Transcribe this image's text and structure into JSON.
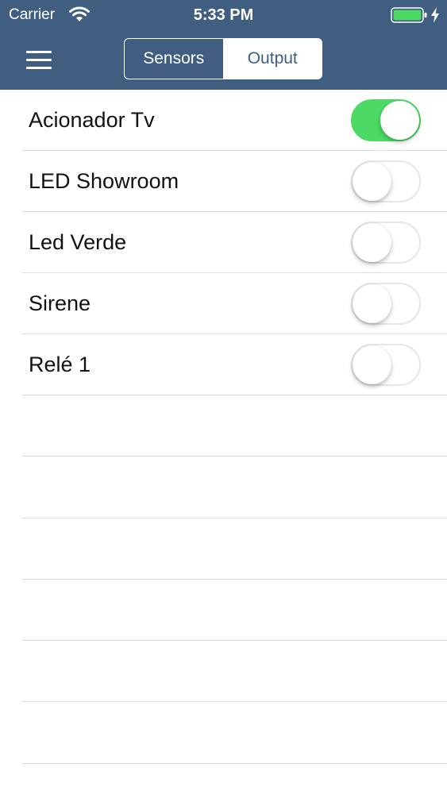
{
  "status_bar": {
    "carrier": "Carrier",
    "time": "5:33 PM",
    "battery_color": "#4cd964"
  },
  "nav": {
    "menu_icon": "hamburger-menu-icon",
    "segments": [
      {
        "label": "Sensors",
        "selected": false
      },
      {
        "label": "Output",
        "selected": true
      }
    ],
    "background_color": "#3f5e80"
  },
  "outputs": [
    {
      "label": "Acionador Tv",
      "on": true
    },
    {
      "label": "LED Showroom",
      "on": false
    },
    {
      "label": "Led Verde",
      "on": false
    },
    {
      "label": "Sirene",
      "on": false
    },
    {
      "label": "Relé 1",
      "on": false
    }
  ],
  "toggle_on_color": "#4cd964"
}
